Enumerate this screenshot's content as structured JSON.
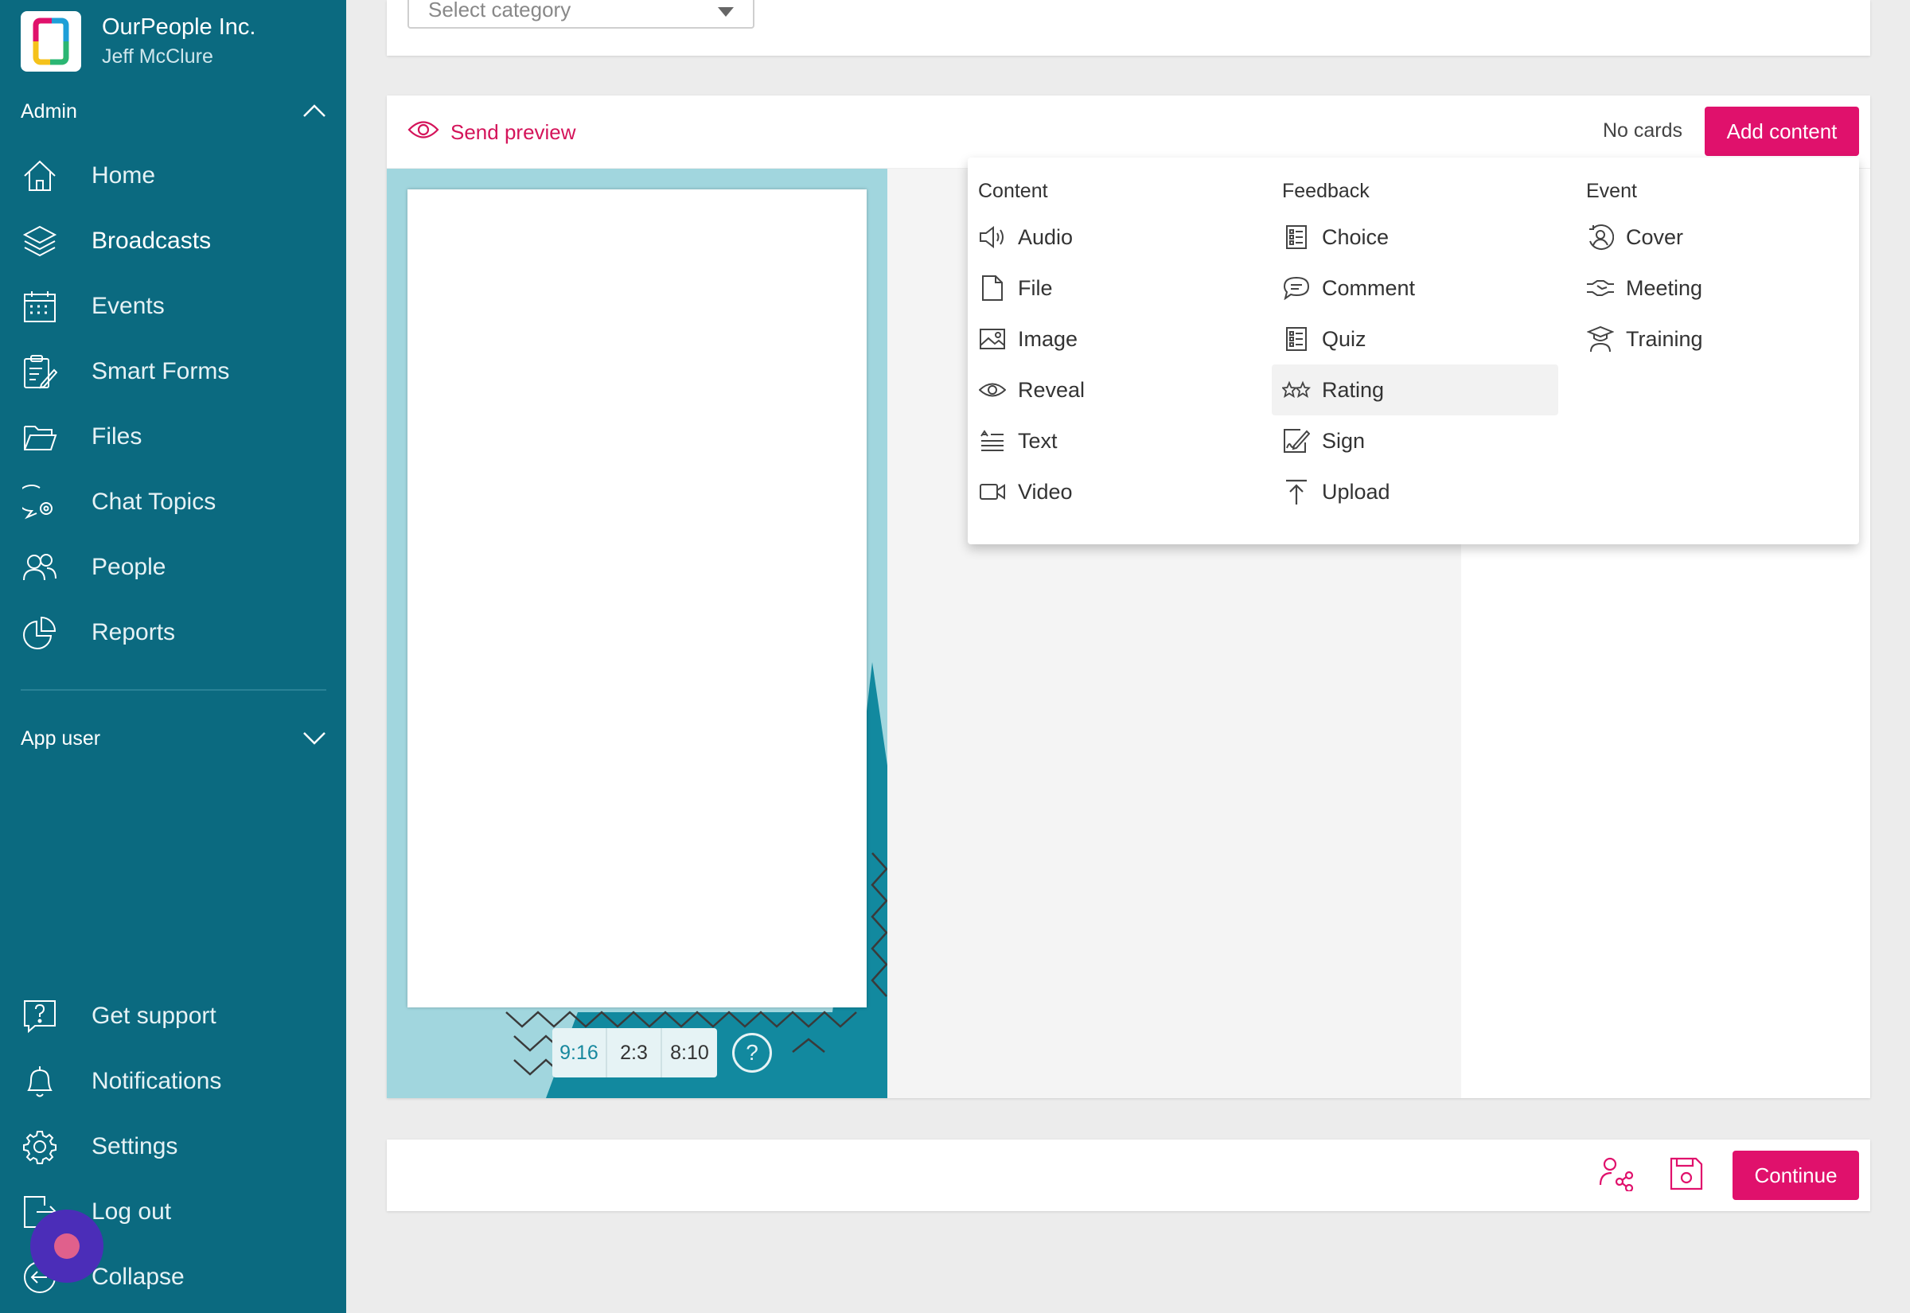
{
  "org": {
    "name": "OurPeople Inc.",
    "user": "Jeff McClure"
  },
  "sidebar": {
    "admin_label": "Admin",
    "app_user_label": "App user",
    "items": [
      {
        "label": "Home",
        "icon": "home-icon"
      },
      {
        "label": "Broadcasts",
        "icon": "layers-icon"
      },
      {
        "label": "Events",
        "icon": "calendar-icon"
      },
      {
        "label": "Smart Forms",
        "icon": "form-icon"
      },
      {
        "label": "Files",
        "icon": "folder-icon"
      },
      {
        "label": "Chat Topics",
        "icon": "chat-gear-icon"
      },
      {
        "label": "People",
        "icon": "people-icon"
      },
      {
        "label": "Reports",
        "icon": "pie-chart-icon"
      }
    ],
    "bottom_items": [
      {
        "label": "Get support",
        "icon": "help-icon"
      },
      {
        "label": "Notifications",
        "icon": "bell-icon"
      },
      {
        "label": "Settings",
        "icon": "gear-icon"
      },
      {
        "label": "Log out",
        "icon": "logout-icon"
      },
      {
        "label": "Collapse",
        "icon": "collapse-icon"
      }
    ]
  },
  "category_select": {
    "placeholder": "Select category"
  },
  "editor": {
    "send_preview": "Send preview",
    "no_cards": "No cards",
    "add_content": "Add content",
    "ratios": [
      "9:16",
      "2:3",
      "8:10"
    ],
    "selected_ratio": "9:16",
    "help": "?"
  },
  "dropdown": {
    "content": {
      "heading": "Content",
      "items": [
        {
          "label": "Audio",
          "icon": "speaker-icon"
        },
        {
          "label": "File",
          "icon": "file-icon"
        },
        {
          "label": "Image",
          "icon": "image-icon"
        },
        {
          "label": "Reveal",
          "icon": "eye-icon"
        },
        {
          "label": "Text",
          "icon": "text-lines-icon"
        },
        {
          "label": "Video",
          "icon": "video-icon"
        }
      ]
    },
    "feedback": {
      "heading": "Feedback",
      "items": [
        {
          "label": "Choice",
          "icon": "checklist-icon"
        },
        {
          "label": "Comment",
          "icon": "speech-bubble-icon"
        },
        {
          "label": "Quiz",
          "icon": "quiz-icon"
        },
        {
          "label": "Rating",
          "icon": "stars-icon"
        },
        {
          "label": "Sign",
          "icon": "signature-icon"
        },
        {
          "label": "Upload",
          "icon": "upload-icon"
        }
      ]
    },
    "event": {
      "heading": "Event",
      "items": [
        {
          "label": "Cover",
          "icon": "cover-icon"
        },
        {
          "label": "Meeting",
          "icon": "handshake-icon"
        },
        {
          "label": "Training",
          "icon": "graduate-icon"
        }
      ]
    }
  },
  "footer": {
    "continue": "Continue"
  },
  "colors": {
    "sidebar": "#0b6a80",
    "accent": "#e0116c",
    "canvas": "#a1d6de",
    "fab": "#4b2db8"
  }
}
